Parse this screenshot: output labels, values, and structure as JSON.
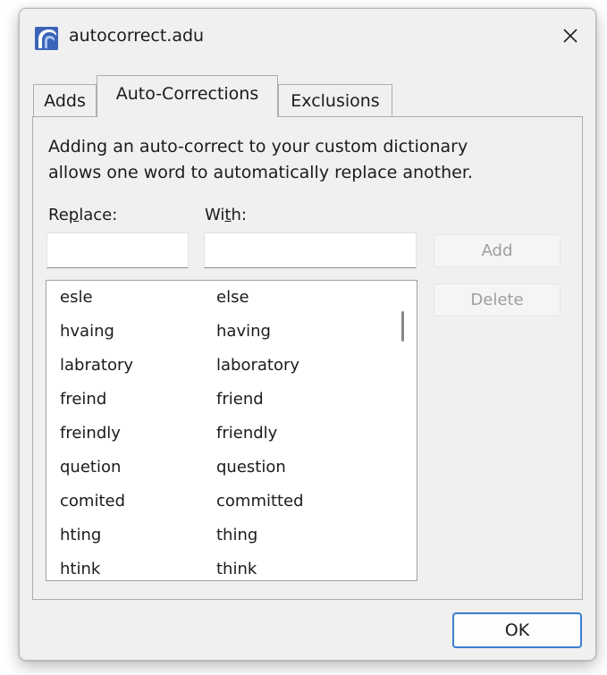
{
  "window": {
    "title": "autocorrect.adu",
    "close_glyph": "✕",
    "app_icon": "app-logo-icon"
  },
  "tabs": [
    {
      "label": "Adds"
    },
    {
      "label": "Auto-Corrections"
    },
    {
      "label": "Exclusions"
    }
  ],
  "panel": {
    "description_line1": "Adding an auto-correct to your custom dictionary",
    "description_line2": "allows one word to automatically replace another.",
    "replace_label_pre": "Re",
    "replace_label_key": "p",
    "replace_label_post": "lace:",
    "with_label_pre": "Wi",
    "with_label_key": "t",
    "with_label_post": "h:",
    "replace_value": "",
    "with_value": "",
    "add_label": "Add",
    "delete_label": "Delete"
  },
  "corrections": [
    {
      "from": "esle",
      "to": "else"
    },
    {
      "from": "hvaing",
      "to": "having"
    },
    {
      "from": "labratory",
      "to": "laboratory"
    },
    {
      "from": "freind",
      "to": "friend"
    },
    {
      "from": "freindly",
      "to": "friendly"
    },
    {
      "from": "quetion",
      "to": "question"
    },
    {
      "from": "comited",
      "to": "committed"
    },
    {
      "from": "hting",
      "to": "thing"
    },
    {
      "from": "htink",
      "to": "think"
    }
  ],
  "footer": {
    "ok_label": "OK"
  },
  "colors": {
    "accent": "#3a7fd0",
    "icon_blue": "#3c64b8"
  }
}
